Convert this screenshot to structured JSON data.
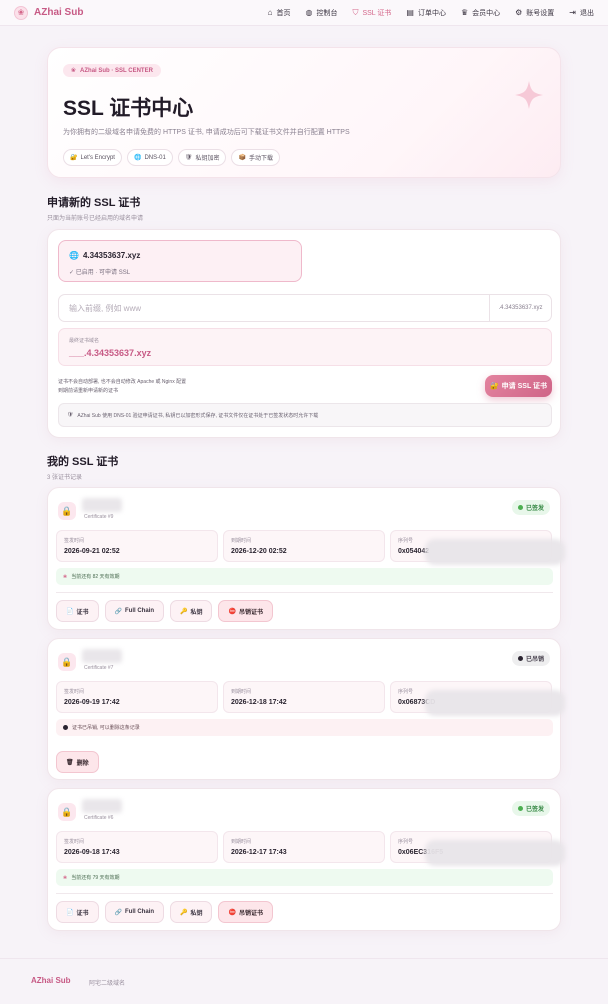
{
  "nav": {
    "brand": "AZhai Sub",
    "items": [
      {
        "label": "首页",
        "icon": "⌂",
        "icon_name": "home-icon",
        "active": false
      },
      {
        "label": "控制台",
        "icon": "◍",
        "icon_name": "globe-icon",
        "active": false
      },
      {
        "label": "SSL 证书",
        "icon": "⛉",
        "icon_name": "shield-icon",
        "active": true
      },
      {
        "label": "订单中心",
        "icon": "▤",
        "icon_name": "orders-icon",
        "active": false
      },
      {
        "label": "会员中心",
        "icon": "♛",
        "icon_name": "crown-icon",
        "active": false
      },
      {
        "label": "账号设置",
        "icon": "⚙",
        "icon_name": "settings-icon",
        "active": false
      },
      {
        "label": "退出",
        "icon": "⇥",
        "icon_name": "logout-icon",
        "active": false
      }
    ]
  },
  "hero": {
    "badge": "AZhai Sub · SSL CENTER",
    "title": "SSL 证书中心",
    "desc": "为你拥有的二级域名申请免费的 HTTPS 证书, 申请成功后可下载证书文件并自行配置 HTTPS",
    "tags": [
      "Let's Encrypt",
      "DNS-01",
      "私钥加密",
      "手动下载"
    ]
  },
  "apply": {
    "title": "申请新的 SSL 证书",
    "subtitle": "只面为当前账号已经启用的域名申请",
    "domain": {
      "name": "4.34353637.xyz",
      "status": "✓ 已启用 · 可申请 SSL"
    },
    "prefix_placeholder": "输入前缀, 例如 www",
    "suffix": ".4.34353637.xyz",
    "final_label": "最终证书域名",
    "final_value": "___.4.34353637.xyz",
    "hint1": "证书不会自动部署, 也不会自动修改 Apache 或 Nginx 配置",
    "hint2": "到期前请重新申请新的证书",
    "button": "申请 SSL 证书",
    "info": "AZhai Sub 使用 DNS-01 验证申请证书, 私钥已以加密形式保存, 证书文件仅在证书处于已签发状态时允许下载"
  },
  "certs_section": {
    "title": "我的 SSL 证书",
    "subtitle": "3 张证书记录"
  },
  "certs": [
    {
      "id_label": "Certificate #9",
      "status": "已签发",
      "issued_label": "签发时间",
      "issued": "2026-09-21 02:52",
      "expires_label": "到期时间",
      "expires": "2026-12-20 02:52",
      "serial_label": "序列号",
      "serial": "0x054042",
      "note": "当前还有 82 天有效期",
      "buttons": [
        "证书",
        "Full Chain",
        "私钥",
        "吊销证书"
      ]
    },
    {
      "id_label": "Certificate #7",
      "status": "已吊销",
      "issued_label": "签发时间",
      "issued": "2026-09-19 17:42",
      "expires_label": "到期时间",
      "expires": "2026-12-18 17:42",
      "serial_label": "序列号",
      "serial": "0x06873CD",
      "note": "证书已吊销, 可以删除这条记录",
      "buttons": [
        "删除"
      ]
    },
    {
      "id_label": "Certificate #6",
      "status": "已签发",
      "issued_label": "签发时间",
      "issued": "2026-09-18 17:43",
      "expires_label": "到期时间",
      "expires": "2026-12-17 17:43",
      "serial_label": "序列号",
      "serial": "0x06EC316F5",
      "note": "当前还有 79 天有效期",
      "buttons": [
        "证书",
        "Full Chain",
        "私钥",
        "吊销证书"
      ]
    }
  ],
  "footer": {
    "brand": "AZhai Sub",
    "text": "阿宅二级域名"
  },
  "colors": {
    "accent": "#d4668a",
    "ok": "#3a8b48",
    "revoked": "#4a4450"
  }
}
